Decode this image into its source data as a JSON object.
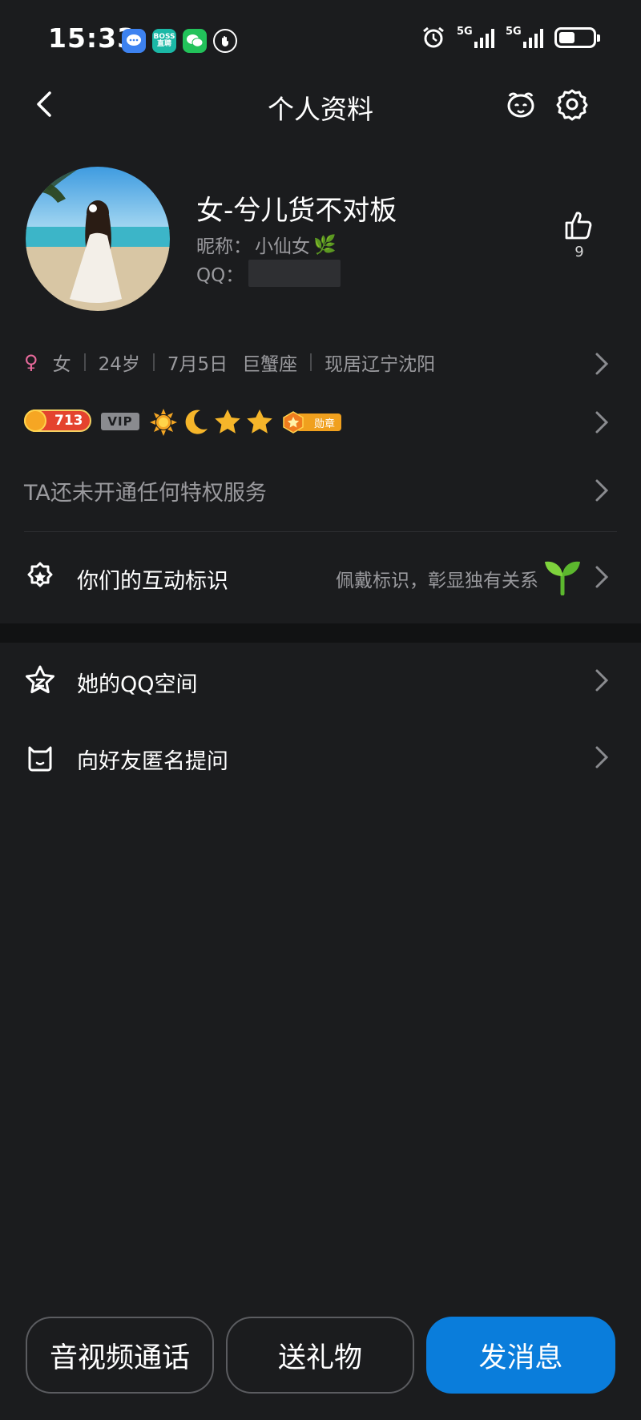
{
  "status_bar": {
    "time": "15:33",
    "apps": [
      {
        "icon": "message-app-icon"
      },
      {
        "icon": "boss-zhipin-app-icon",
        "label_top": "BOSS",
        "label_bottom": "直聘"
      },
      {
        "icon": "wechat-app-icon"
      },
      {
        "icon": "hand-app-icon"
      }
    ],
    "network_1": "5G",
    "network_2": "5G",
    "battery_level": 0.48
  },
  "nav": {
    "title": "个人资料",
    "back_icon": "chevron-left-icon",
    "pet_icon": "pet-face-icon",
    "settings_icon": "gear-icon"
  },
  "profile": {
    "name": "女-兮儿货不对板",
    "nickname_label": "昵称：",
    "nickname": "小仙女",
    "nickname_emoji": "🌿",
    "qq_label": "QQ：",
    "like_count": "9"
  },
  "info": {
    "gender": "女",
    "age": "24岁",
    "birthday": "7月5日",
    "zodiac": "巨蟹座",
    "location": "现居辽宁沈阳"
  },
  "badges": {
    "level": "713",
    "vip": "VIP",
    "medal_label": "勋章"
  },
  "privilege_text": "TA还未开通任何特权服务",
  "interact": {
    "label": "你们的互动标识",
    "hint": "佩戴标识，彰显独有关系"
  },
  "menu": {
    "qzone": "她的QQ空间",
    "anon_ask": "向好友匿名提问"
  },
  "bottom_bar": {
    "call": "音视频通话",
    "gift": "送礼物",
    "message": "发消息"
  },
  "colors": {
    "background": "#1b1c1e",
    "accent": "#0a7ddb",
    "secondary_text": "#9a9a9e",
    "gender_female": "#e86a9c"
  }
}
